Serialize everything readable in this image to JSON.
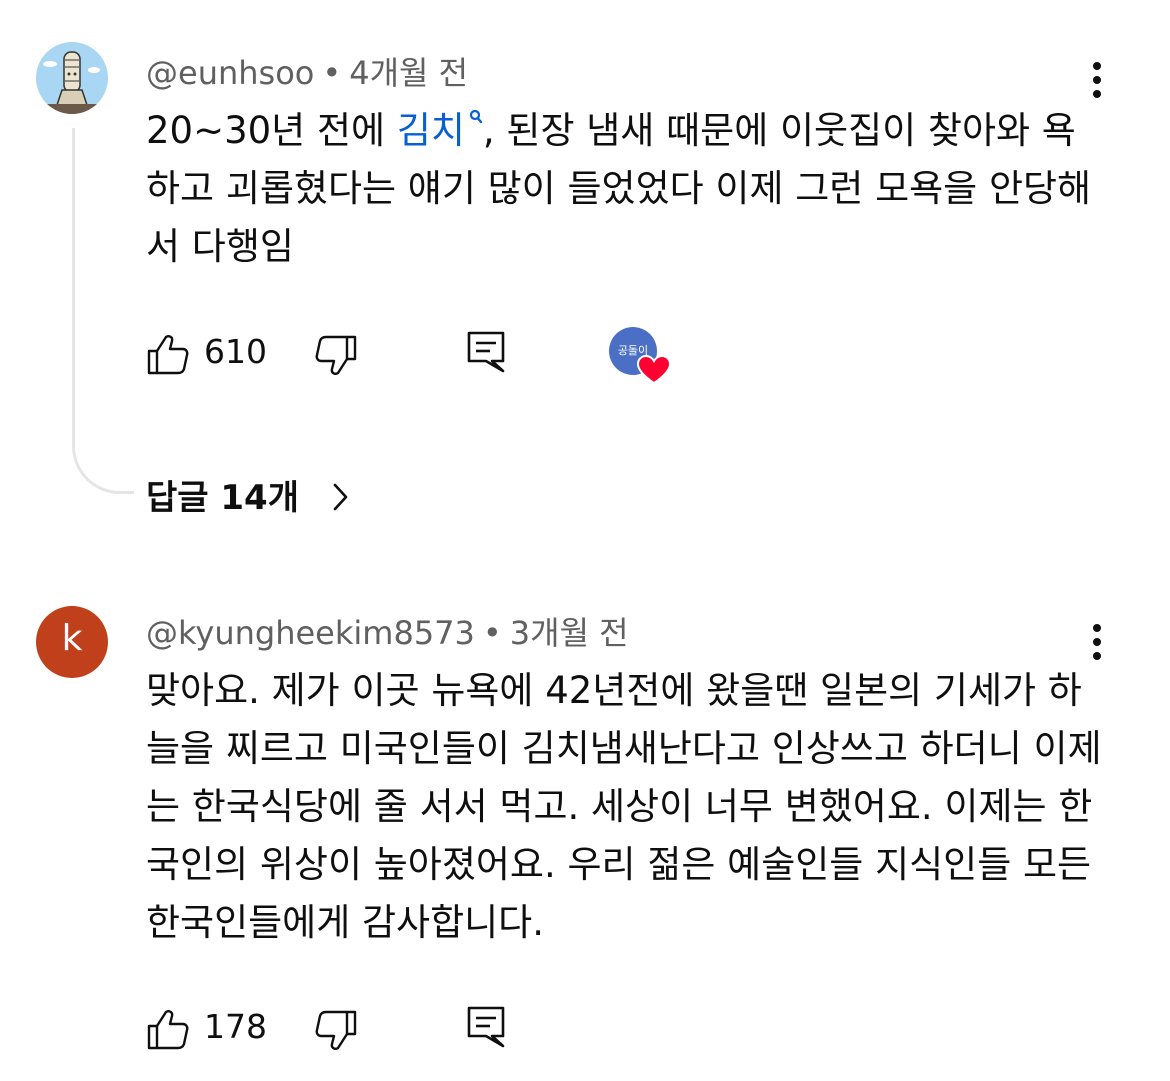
{
  "comments": [
    {
      "author": "@eunhsoo",
      "time": "4개월 전",
      "avatar_icon": "cartoon-avatar-icon",
      "text_before_link": "20~30년 전에 ",
      "link_text": "김치",
      "text_after_link": ",  된장 냄새 때문에   이웃집이 찾아와 욕하고 괴롭혔다는 얘기 많이 들었었다   이제 그런 모욕을 안당해서 다행임",
      "likes": "610",
      "hearted_by_avatar_text": "공돌이",
      "replies_label": "답글 14개"
    },
    {
      "author": "@kyungheekim8573",
      "time": "3개월 전",
      "avatar_letter": "k",
      "avatar_color": "#c1401c",
      "text": "맞아요. 제가 이곳 뉴욕에 42년전에 왔을땐 일본의 기세가 하늘을 찌르고 미국인들이 김치냄새난다고 인상쓰고 하더니 이제는 한국식당에 줄 서서 먹고. 세상이 너무 변했어요. 이제는 한국인의 위상이 높아졌어요. 우리 젊은 예술인들 지식인들 모든 한국인들에게 감사합니다.",
      "likes": "178"
    }
  ],
  "colors": {
    "link": "#065fd4",
    "meta": "#606060",
    "heart": "#ff0033",
    "creator_avatar": "#4a6fc4"
  }
}
